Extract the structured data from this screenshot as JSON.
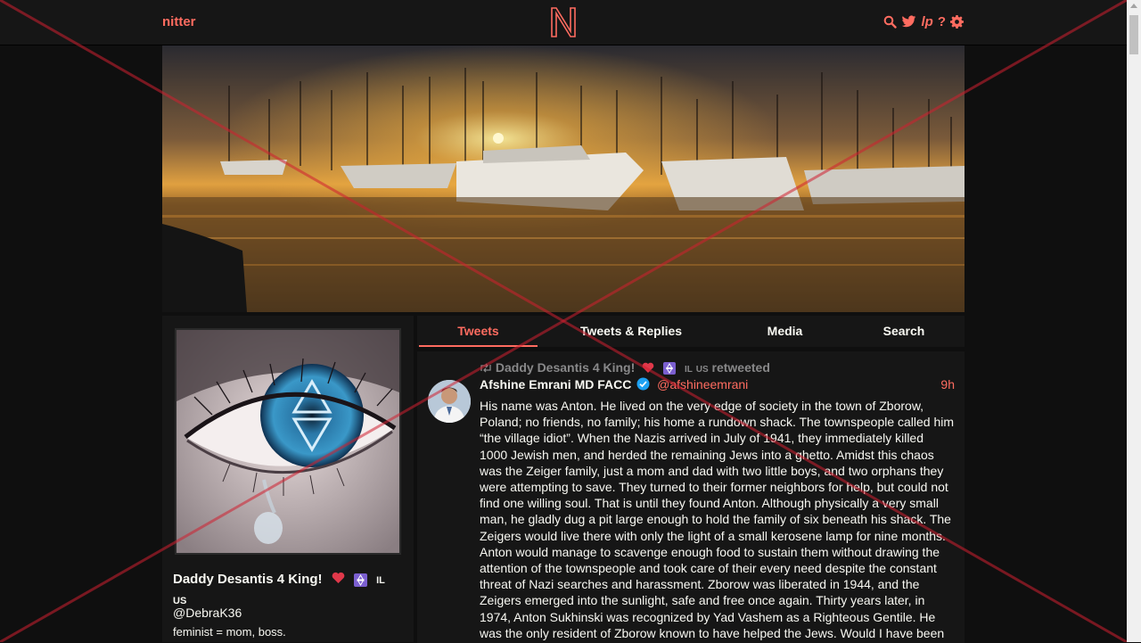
{
  "navbar": {
    "brand": "nitter",
    "icons": [
      "search-icon",
      "twitter-bird-icon",
      "lp-icon",
      "help-icon",
      "gear-icon"
    ],
    "lp_label": "lp",
    "help_label": "?"
  },
  "colors": {
    "accent": "#ff6c60",
    "background": "#0f0f0f",
    "panel": "#161616",
    "text": "#f8f8f2",
    "muted": "#888889",
    "verified": "#1da1f2"
  },
  "tabs": [
    {
      "label": "Tweets",
      "active": true
    },
    {
      "label": "Tweets & Replies",
      "active": false
    },
    {
      "label": "Media",
      "active": false
    },
    {
      "label": "Search",
      "active": false
    }
  ],
  "profile": {
    "fullname": "Daddy Desantis 4 King! ❤️ ✡️ 🇮🇱 🇺🇸",
    "fullname_text": "Daddy Desantis 4 King!",
    "flag_il": "IL",
    "flag_us": "US",
    "username": "@DebraK36",
    "bio": "feminist =  mom, boss."
  },
  "tweet": {
    "retweet_by": "Daddy Desantis 4 King!",
    "retweet_suffix": "retweeted",
    "fullname": "Afshine Emrani MD FACC",
    "username": "@afshineemrani",
    "date": "9h",
    "content": "His name was Anton. He lived on the very edge of society in the town of Zborow, Poland; no friends, no family; his home a rundown shack. The townspeople called him “the village idiot”. When the Nazis arrived in July of 1941, they immediately killed 1000 Jewish men, and herded the remaining Jews into a ghetto. Amidst this chaos was the Zeiger family, just a mom and dad with two little boys, and two orphans they were attempting to save. They turned to their former neighbors for help, but could not find one willing soul. That is until they found Anton. Although physically a very small man, he gladly dug a pit large enough to hold the family of six beneath his shack. The Zeigers would live there with only the light of a small kerosene lamp for nine months. Anton would manage to scavenge enough food to sustain them without drawing the attention of the townspeople and took care of their every need despite the constant threat of Nazi searches and harassment. Zborow was liberated in 1944, and the Zeigers emerged into the sunlight, safe and free once again. Thirty years later, in 1974, Anton Sukhinski was recognized by Yad Vashem as a Righteous Gentile. He was the only resident of Zborow known to have helped the Jews. Would I have been"
  }
}
